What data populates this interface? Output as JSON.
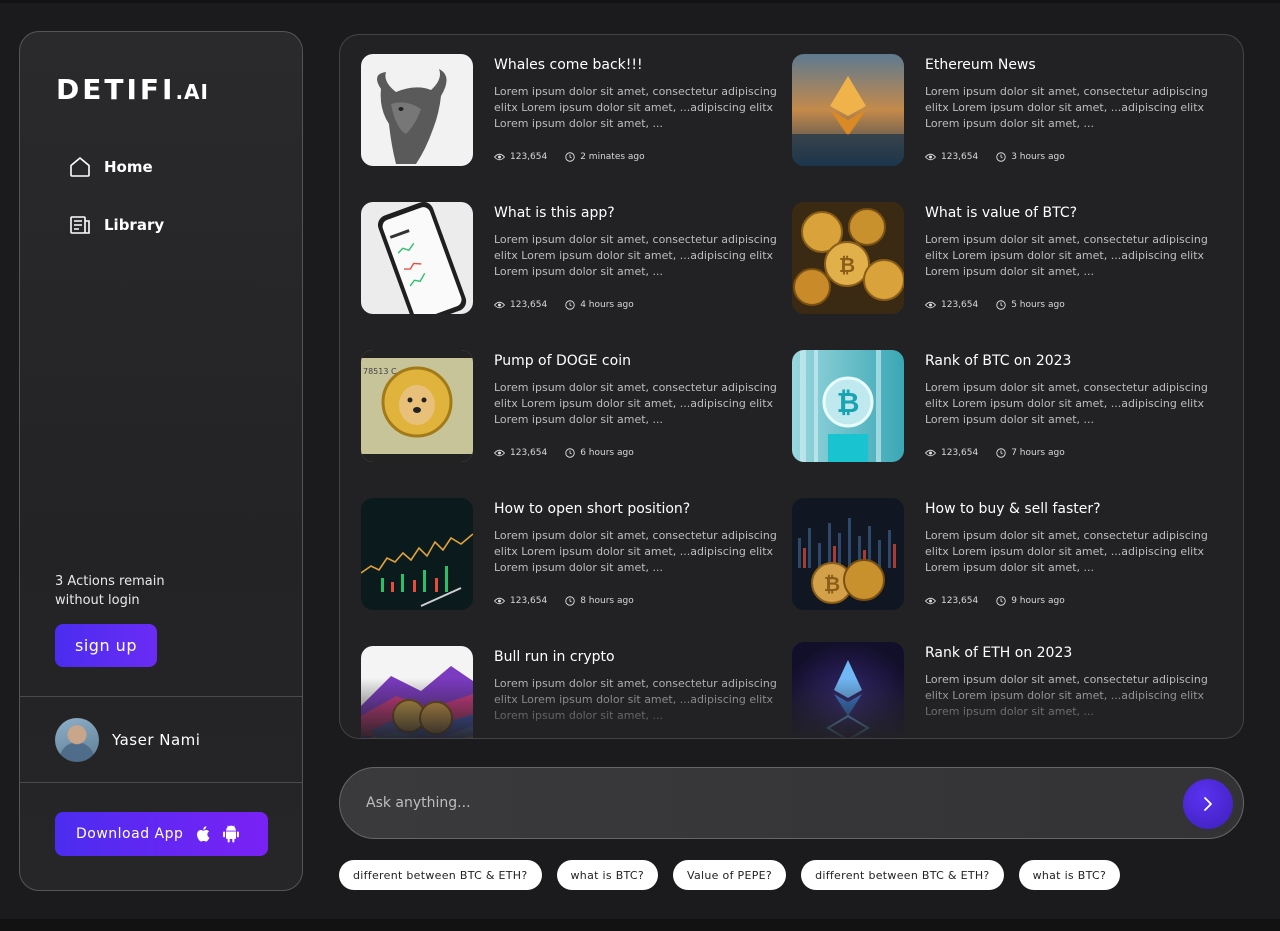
{
  "logo": {
    "main": "DETIFI",
    "suffix": ".AI"
  },
  "nav": [
    {
      "label": "Home",
      "icon": "home-icon"
    },
    {
      "label": "Library",
      "icon": "library-icon"
    }
  ],
  "sidebar": {
    "actions_line1": "3 Actions remain",
    "actions_line2": "without login",
    "signup_label": "sign up",
    "user_name": "Yaser Nami",
    "download_label": "Download App"
  },
  "feed": {
    "cards": [
      {
        "title": "Whales come back!!!",
        "desc": "Lorem ipsum dolor sit amet, consectetur adipiscing elitx Lorem ipsum dolor sit amet, ...adipiscing elitx Lorem ipsum dolor sit amet, ...",
        "views": "123,654",
        "time": "2 minates ago"
      },
      {
        "title": "Ethereum News",
        "desc": "Lorem ipsum dolor sit amet, consectetur adipiscing elitx Lorem ipsum dolor sit amet, ...adipiscing elitx Lorem ipsum dolor sit amet, ...",
        "views": "123,654",
        "time": "3 hours ago"
      },
      {
        "title": "What is this app?",
        "desc": "Lorem ipsum dolor sit amet, consectetur adipiscing elitx Lorem ipsum dolor sit amet, ...adipiscing elitx Lorem ipsum dolor sit amet, ...",
        "views": "123,654",
        "time": "4 hours ago"
      },
      {
        "title": "What is value of BTC?",
        "desc": "Lorem ipsum dolor sit amet, consectetur adipiscing elitx Lorem ipsum dolor sit amet, ...adipiscing elitx Lorem ipsum dolor sit amet, ...",
        "views": "123,654",
        "time": "5 hours ago"
      },
      {
        "title": "Pump of DOGE coin",
        "desc": "Lorem ipsum dolor sit amet, consectetur adipiscing elitx Lorem ipsum dolor sit amet, ...adipiscing elitx Lorem ipsum dolor sit amet, ...",
        "views": "123,654",
        "time": "6 hours ago"
      },
      {
        "title": "Rank of BTC on 2023",
        "desc": "Lorem ipsum dolor sit amet, consectetur adipiscing elitx Lorem ipsum dolor sit amet, ...adipiscing elitx Lorem ipsum dolor sit amet, ...",
        "views": "123,654",
        "time": "7 hours ago"
      },
      {
        "title": "How to open short position?",
        "desc": "Lorem ipsum dolor sit amet, consectetur adipiscing elitx Lorem ipsum dolor sit amet, ...adipiscing elitx Lorem ipsum dolor sit amet, ...",
        "views": "123,654",
        "time": "8 hours ago"
      },
      {
        "title": "How to buy & sell faster?",
        "desc": "Lorem ipsum dolor sit amet, consectetur adipiscing elitx Lorem ipsum dolor sit amet, ...adipiscing elitx Lorem ipsum dolor sit amet, ...",
        "views": "123,654",
        "time": "9 hours ago"
      },
      {
        "title": "Bull run in crypto",
        "desc": "Lorem ipsum dolor sit amet, consectetur adipiscing elitx Lorem ipsum dolor sit amet, ...adipiscing elitx Lorem ipsum dolor sit amet, ...",
        "views": "",
        "time": ""
      },
      {
        "title": "Rank of ETH on 2023",
        "desc": "Lorem ipsum dolor sit amet, consectetur adipiscing elitx Lorem ipsum dolor sit amet, ...adipiscing elitx Lorem ipsum dolor sit amet, ...",
        "views": "",
        "time": ""
      }
    ]
  },
  "ask": {
    "placeholder": "Ask anything..."
  },
  "chips": [
    "different between BTC & ETH?",
    "what is BTC?",
    "Value of PEPE?",
    "different between BTC & ETH?",
    "what is BTC?"
  ],
  "colors": {
    "accent": "#4b2cf0",
    "accent2": "#7a22f5",
    "background": "#1b1b1d"
  }
}
